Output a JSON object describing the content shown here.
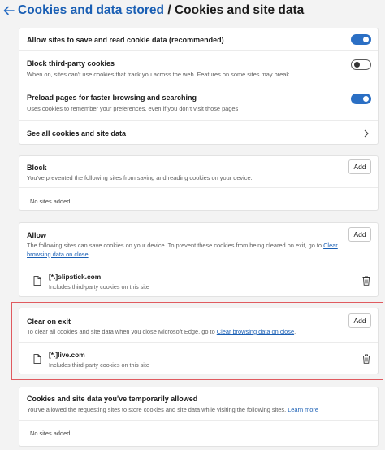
{
  "header": {
    "parent_link": "Cookies and data stored",
    "separator": "/",
    "title": "Cookies and site data"
  },
  "settings": {
    "allow_save": {
      "title": "Allow sites to save and read cookie data (recommended)",
      "enabled": true
    },
    "block_third_party": {
      "title": "Block third-party cookies",
      "description": "When on, sites can't use cookies that track you across the web. Features on some sites may break.",
      "enabled": false
    },
    "preload": {
      "title": "Preload pages for faster browsing and searching",
      "description": "Uses cookies to remember your preferences, even if you don't visit those pages",
      "enabled": true
    },
    "see_all": {
      "label": "See all cookies and site data"
    }
  },
  "block": {
    "title": "Block",
    "description": "You've prevented the following sites from saving and reading cookies on your device.",
    "add_label": "Add",
    "empty": "No sites added"
  },
  "allow": {
    "title": "Allow",
    "description_1": "The following sites can save cookies on your device. To prevent these cookies from being cleared on exit, go to",
    "link_1": "Clear",
    "link_2": "browsing data on close",
    "description_end": ".",
    "add_label": "Add",
    "sites": [
      {
        "name": "[*.]slipstick.com",
        "sub": "Includes third-party cookies on this site"
      }
    ]
  },
  "clear_on_exit": {
    "title": "Clear on exit",
    "description": "To clear all cookies and site data when you close Microsoft Edge, go to",
    "link": "Clear browsing data on close",
    "description_end": ".",
    "add_label": "Add",
    "sites": [
      {
        "name": "[*.]live.com",
        "sub": "Includes third-party cookies on this site"
      }
    ]
  },
  "temporary": {
    "title": "Cookies and site data you've temporarily allowed",
    "description": "You've allowed the requesting sites to store cookies and site data while visiting the following sites.",
    "link": "Learn more",
    "empty": "No sites added"
  },
  "colors": {
    "accent": "#2b6fc4",
    "link": "#1a5fb4",
    "highlight": "#e05a5f"
  }
}
